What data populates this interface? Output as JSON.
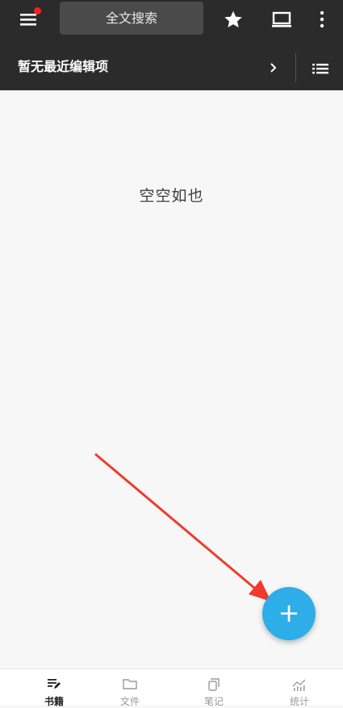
{
  "header": {
    "search_label": "全文搜索",
    "recent_title": "暂无最近编辑项"
  },
  "main": {
    "empty_text": "空空如也"
  },
  "fab": {
    "label": "+"
  },
  "bottom_nav": {
    "items": [
      {
        "label": "书籍",
        "icon": "book-edit-icon",
        "active": true
      },
      {
        "label": "文件",
        "icon": "folder-icon",
        "active": false
      },
      {
        "label": "笔记",
        "icon": "notes-icon",
        "active": false
      },
      {
        "label": "统计",
        "icon": "stats-icon",
        "active": false
      }
    ]
  },
  "colors": {
    "topbar": "#2b2b2b",
    "search_box": "#4a4a4a",
    "notification_dot": "#ff1f1f",
    "fab": "#2eaee8",
    "annotation_arrow": "#f03a2e",
    "background": "#f7f7f7"
  }
}
